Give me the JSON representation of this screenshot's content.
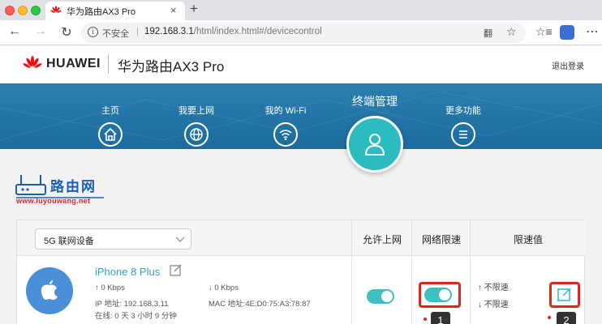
{
  "browser": {
    "tab_title": "华为路由AX3 Pro",
    "tab_close": "×",
    "new_tab": "+",
    "nav_back": "←",
    "nav_forward": "→",
    "nav_reload": "↻",
    "url_security": "不安全",
    "url_host": "192.168.3.1",
    "url_path": "/html/index.html#/devicecontrol",
    "translate_icon": "翻",
    "star_icon": "☆",
    "collections_icon": "☆≡",
    "more_icon": "⋯"
  },
  "header": {
    "brand": "HUAWEI",
    "product": "华为路由AX3 Pro",
    "logout": "退出登录"
  },
  "nav": {
    "home": "主页",
    "online": "我要上网",
    "wifi": "我的 Wi-Fi",
    "active": "终端管理",
    "more": "更多功能"
  },
  "watermark": {
    "cn": "路由网",
    "url": "www.luyouwang.net"
  },
  "table": {
    "filter": "5G 联网设备",
    "headers": {
      "allow": "允许上网",
      "limit": "网络限速",
      "value": "限速值"
    },
    "device": {
      "name": "iPhone 8 Plus",
      "up": "↑ 0 Kbps",
      "down": "↓ 0 Kbps",
      "ip": "IP 地址: 192.168.3.11",
      "mac": "MAC 地址:4E:D0:75:A3:78:87",
      "online": "在线: 0 天 3 小时 9 分钟",
      "limit_up": "↑ 不限速",
      "limit_down": "↓ 不限速",
      "allow_on": true,
      "limit_on": true
    },
    "markers": [
      "1",
      "2"
    ]
  },
  "colors": {
    "accent": "#2cbcc0",
    "banner": "#1d6b9e",
    "highlight": "#e0251b"
  }
}
